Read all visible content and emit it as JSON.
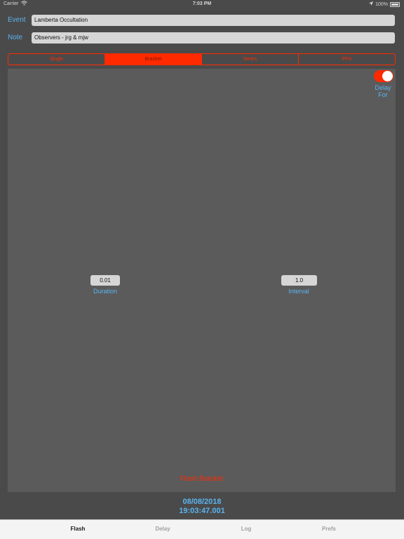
{
  "status_bar": {
    "carrier": "Carrier",
    "time": "7:03 PM",
    "battery": "100%"
  },
  "form": {
    "event_label": "Event",
    "event_value": "Lamberta Occultation",
    "note_label": "Note",
    "note_value": "Observers - jrg & mjw"
  },
  "segments": [
    {
      "label": "Single",
      "selected": false
    },
    {
      "label": "Bracket",
      "selected": true
    },
    {
      "label": "Series",
      "selected": false
    },
    {
      "label": "FPS",
      "selected": false
    }
  ],
  "delay_toggle": {
    "label_line1": "Delay",
    "label_line2": "For",
    "on": true
  },
  "duration": {
    "value": "0.01",
    "caption": "Duration"
  },
  "interval": {
    "value": "1.0",
    "caption": "Interval"
  },
  "flash_button_label": "Flash Bracket",
  "clock": {
    "date": "08/08/2018",
    "time": "19:03:47.001"
  },
  "tabs": [
    {
      "label": "Flash",
      "active": true
    },
    {
      "label": "Delay",
      "active": false
    },
    {
      "label": "Log",
      "active": false
    },
    {
      "label": "Prefs",
      "active": false
    }
  ],
  "colors": {
    "accent_red": "#ff2a00",
    "accent_blue": "#5ab4f0",
    "background": "#4a4a4a",
    "panel": "#5b5b5b"
  }
}
